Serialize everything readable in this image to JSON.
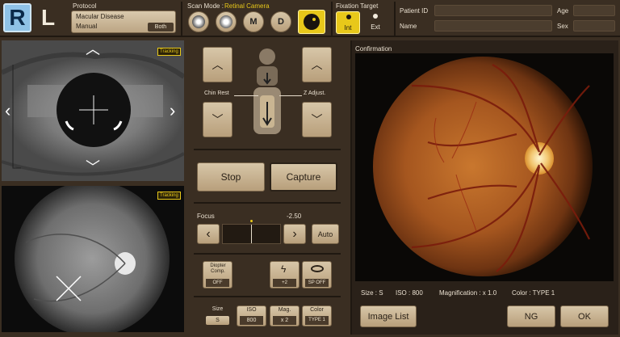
{
  "eye": {
    "right": "R",
    "left": "L"
  },
  "protocol": {
    "label": "Protocol",
    "name": "Macular Disease",
    "mode": "Manual",
    "mode_value": "Both"
  },
  "scan_mode": {
    "label": "Scan Mode :",
    "value": "Retinal Camera"
  },
  "fixation": {
    "label": "Fixation Target",
    "int": "Int",
    "ext": "Ext"
  },
  "patient": {
    "id_label": "Patient ID",
    "name_label": "Name",
    "age_label": "Age",
    "sex_label": "Sex"
  },
  "live_top": {
    "badge": "Tracking"
  },
  "live_bottom": {
    "badge": "Tracking"
  },
  "controls": {
    "chin_rest": "Chin Rest",
    "z_adjust": "Z Adjust.",
    "stop": "Stop",
    "capture": "Capture",
    "focus_label": "Focus",
    "focus_value": "-2.50",
    "auto": "Auto",
    "diopter_label": "Diopter Comp.",
    "diopter_value": "OFF",
    "flash_value": "+2",
    "sp_value": "SP OFF",
    "size_label": "Size",
    "size_value": "S",
    "iso_label": "ISO",
    "iso_value": "800",
    "mag_label": "Mag.",
    "mag_value": "x 2",
    "color_label": "Color",
    "color_value": "TYPE 1"
  },
  "confirmation": {
    "title": "Confirmation",
    "size": "Size : S",
    "iso": "ISO : 800",
    "magnification": "Magnification : x 1.0",
    "color": "Color : TYPE 1",
    "image_list": "Image List",
    "ng": "NG",
    "ok": "OK"
  },
  "colors": {
    "panel": "#3a2e22",
    "accent_yellow": "#e8c81a",
    "button": "#c9b592"
  }
}
